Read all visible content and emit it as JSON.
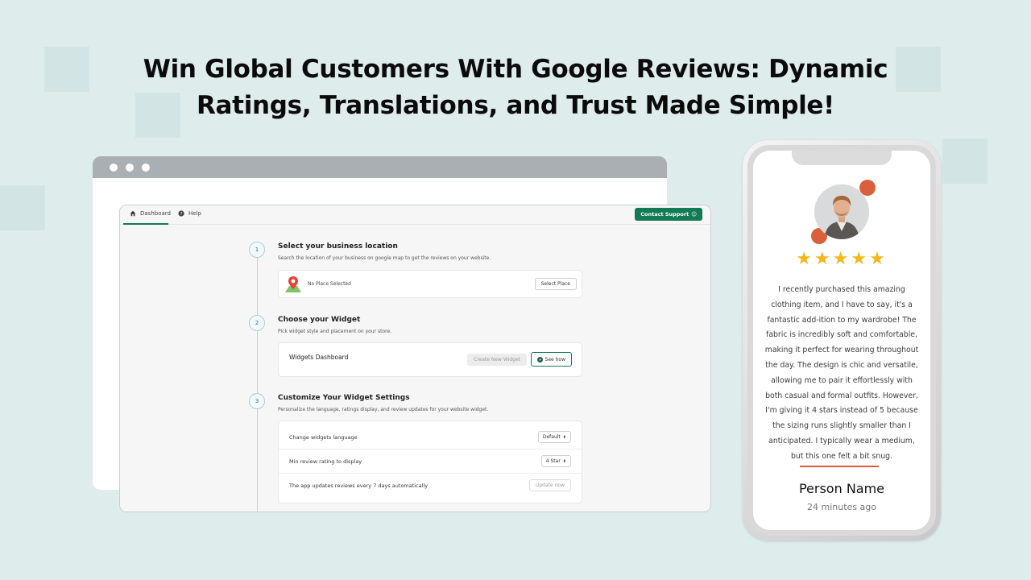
{
  "headline": {
    "line1": "Win Global Customers With Google Reviews: Dynamic",
    "line2": "Ratings, Translations, and Trust Made Simple!"
  },
  "app": {
    "nav": {
      "dashboard_label": "Dashboard",
      "help_label": "Help",
      "contact_label": "Contact Support",
      "contact_icon": "smile-emoji-icon"
    },
    "steps": [
      {
        "number": "1",
        "title": "Select your business location",
        "description": "Search the location of your business on google map to get the reviews on your website.",
        "place_status": "No Place Selected",
        "button": "Select Place",
        "icon": "map-pin-icon"
      },
      {
        "number": "2",
        "title": "Choose your Widget",
        "description": "Pick widget style and placement on your store.",
        "card_title": "Widgets Dashboard",
        "create_button": "Create New Widget",
        "see_button": "See how"
      },
      {
        "number": "3",
        "title": "Customize Your Widget Settings",
        "description": "Personalize the language, ratings display, and review updates for your website widget.",
        "rows": [
          {
            "label": "Change widgets language",
            "value": "Default"
          },
          {
            "label": "Min review rating to display",
            "value": "4 Star"
          },
          {
            "label": "The app updates reviews every 7 days automatically",
            "value": "Update now"
          }
        ]
      }
    ],
    "colors": {
      "accent": "#127a55",
      "timeline": "#b7d7df"
    }
  },
  "phone": {
    "rating": 5,
    "stars": "★★★★★",
    "review_text": "I recently purchased this amazing clothing item, and I have to say, it's a fantastic add-ition to my wardrobe! The fabric is incredibly soft and comfortable, making it perfect for wearing throughout the day. The design is chic and versatile, allowing me to pair it effortlessly with both casual and formal outfits. However, I'm giving it 4 stars instead of 5 because the sizing runs slightly smaller than I anticipated. I typically wear a medium, but this one felt a bit snug.",
    "person_name": "Person Name",
    "time_ago": "24 minutes ago",
    "colors": {
      "star": "#f5b81a",
      "accent": "#d9603a"
    }
  }
}
